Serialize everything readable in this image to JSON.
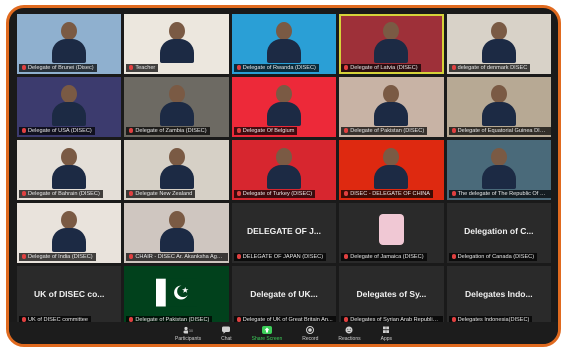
{
  "tiles": [
    {
      "label": "Delegate of Brunei (Disec)",
      "type": "video",
      "bg": "#8fb0cf"
    },
    {
      "label": "Teacher",
      "type": "video",
      "bg": "#ece7de"
    },
    {
      "label": "Delegate of Rwanda (DISEC)",
      "type": "flag",
      "bg": "#2a9fd6"
    },
    {
      "label": "Delegate of Latvia (DISEC)",
      "type": "flag",
      "bg": "#9e3039",
      "active": true
    },
    {
      "label": "delegate of denmark DISEC",
      "type": "video",
      "bg": "#d8d2c8"
    },
    {
      "label": "Delegate of USA (DISEC)",
      "type": "flag",
      "bg": "#3c3b6e"
    },
    {
      "label": "Delegate of Zambia (DISEC)",
      "type": "video",
      "bg": "#6d6a63"
    },
    {
      "label": "Delegate Of Belgium",
      "type": "flag",
      "bg": "#ed2939"
    },
    {
      "label": "Delegate of Pakistan (DISEC)",
      "type": "video",
      "bg": "#c8b3a5"
    },
    {
      "label": "Delegate of Equatorial Guinea DIS...",
      "type": "video",
      "bg": "#b7a994"
    },
    {
      "label": "Delegate of Bahrain (DISEC)",
      "type": "video",
      "bg": "#e4dfd8"
    },
    {
      "label": "Delegate New Zealand",
      "type": "video",
      "bg": "#d6d0c6"
    },
    {
      "label": "Delegate of Turkey (DISEC)",
      "type": "flag",
      "bg": "#d7262f"
    },
    {
      "label": "DISEC - DELEGATE OF CHINA",
      "type": "flag",
      "bg": "#de2910"
    },
    {
      "label": "The delegate of The Republic Of B...",
      "type": "video",
      "bg": "#4a6a7a"
    },
    {
      "label": "Delegate of India (DISEC)",
      "type": "video",
      "bg": "#e9e3dc"
    },
    {
      "label": "CHAIR - DISEC Ar. Akanksha Agarw...",
      "type": "video",
      "bg": "#cfc6c0"
    },
    {
      "label": "DELEGATE OF JAPAN (DISEC)",
      "type": "name",
      "name": "DELEGATE OF J..."
    },
    {
      "label": "Delegate of Jamaica (DISEC)",
      "type": "logo",
      "bg": "#2a2a2a"
    },
    {
      "label": "Delegation of Canada (DISEC)",
      "type": "name",
      "name": "Delegation of C..."
    },
    {
      "label": "UK of DISEC committee",
      "type": "name",
      "name": "UK of DISEC co..."
    },
    {
      "label": "Delegate of Pakistan (DISEC)",
      "type": "pkflag",
      "bg": "#01411c"
    },
    {
      "label": "Delegate of UK of Great Britain An...",
      "type": "name",
      "name": "Delegate of UK..."
    },
    {
      "label": "Delegates of Syrian Arab Republic ...",
      "type": "name",
      "name": "Delegates of Sy..."
    },
    {
      "label": "Delegates Indonesia(DISEC)",
      "type": "name",
      "name": "Delegates Indo..."
    }
  ],
  "toolbar": {
    "participants": "Participants",
    "participants_count": "30",
    "chat": "Chat",
    "share": "Share Screen",
    "record": "Record",
    "reactions": "Reactions",
    "apps": "Apps"
  }
}
